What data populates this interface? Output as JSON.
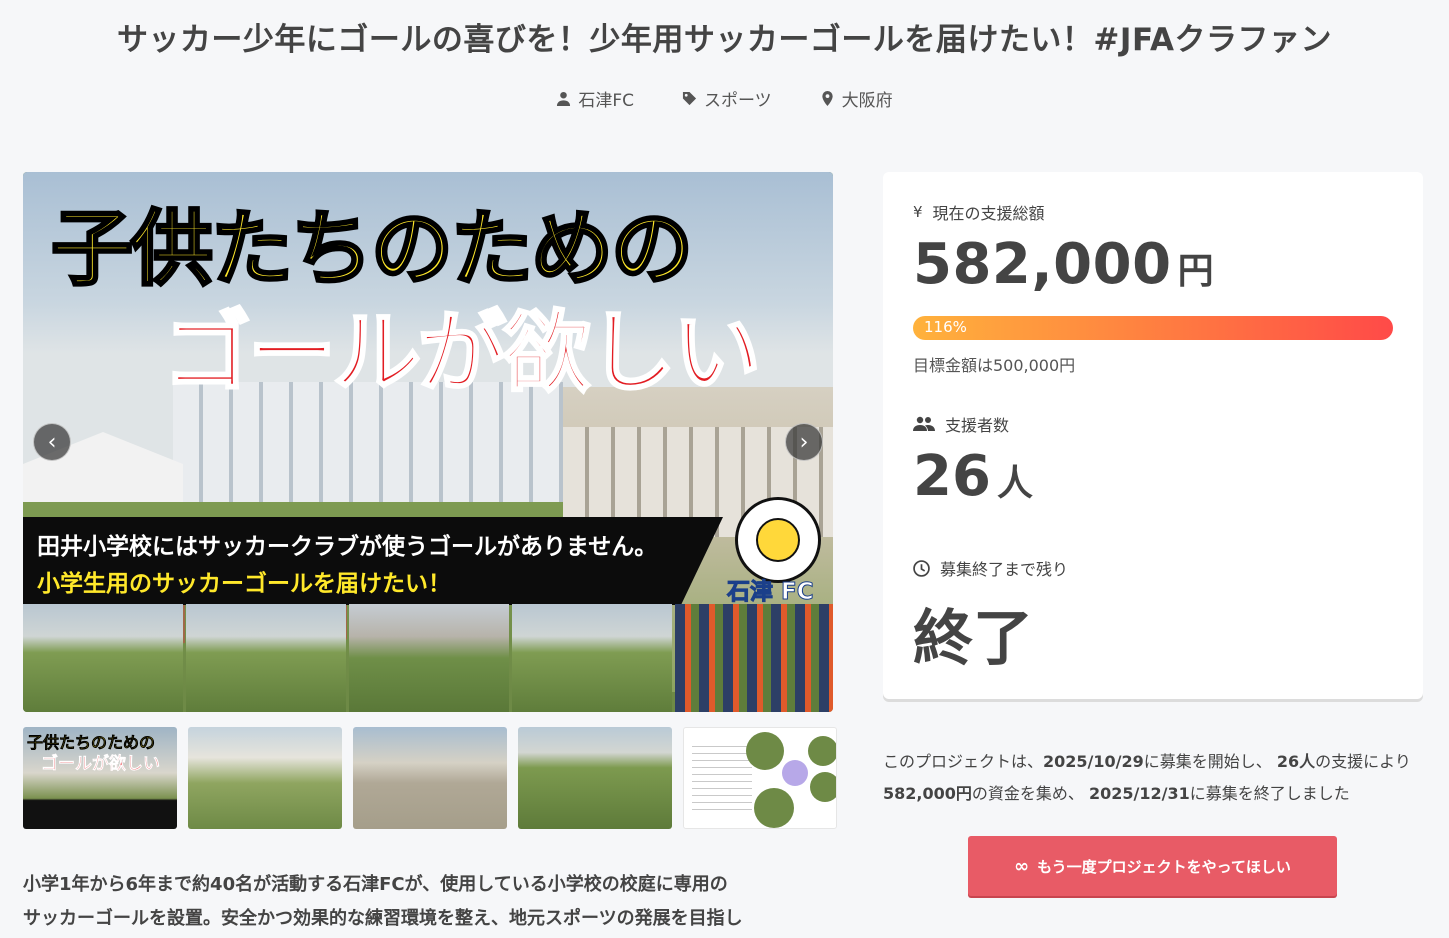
{
  "project": {
    "title": "サッカー少年にゴールの喜びを！少年用サッカーゴールを届けたい！#JFAクラファン",
    "owner": "石津FC",
    "category": "スポーツ",
    "location": "大阪府"
  },
  "hero": {
    "headline1": "子供たちのための",
    "headline2": "ゴールが欲しい",
    "banner_line1": "田井小学校にはサッカークラブが使うゴールがありません。",
    "banner_line2": "小学生用のサッカーゴールを届けたい！",
    "club_name": "石津 FC",
    "prev_icon": "chevron-left-icon",
    "next_icon": "chevron-right-icon"
  },
  "thumbnails": {
    "thumb1_line1": "子供たちのための",
    "thumb1_line2": "ゴールが欲しい"
  },
  "description": {
    "line1": "小学1年から6年まで約40名が活動する石津FCが、使用している小学校の校庭に専用の",
    "line2": "サッカーゴールを設置。安全かつ効果的な練習環境を整え、地元スポーツの発展を目指し"
  },
  "stats": {
    "total_label": "現在の支援総額",
    "total_amount": "582,000",
    "total_unit": "円",
    "progress_percent": 116,
    "progress_label": "116%",
    "goal_text": "目標金額は500,000円",
    "backers_label": "支援者数",
    "backers_count": "26",
    "backers_unit": "人",
    "remaining_label": "募集終了まで残り",
    "remaining_value": "終了"
  },
  "summary": {
    "part1": "このプロジェクトは、",
    "start_date": "2025/10/29",
    "part2": "に募集を開始し、 ",
    "backers": "26人",
    "part3": "の支援により ",
    "amount": "582,000円",
    "part4": "の資金を集め、 ",
    "end_date": "2025/12/31",
    "part5": "に募集を終了しました"
  },
  "cta": {
    "label": "もう一度プロジェクトをやってほしい",
    "icon": "infinity-icon"
  },
  "colors": {
    "accent": "#e85b66",
    "progress_start": "#ffb23c",
    "progress_end": "#ff4a48",
    "background": "#f6f7f9"
  }
}
